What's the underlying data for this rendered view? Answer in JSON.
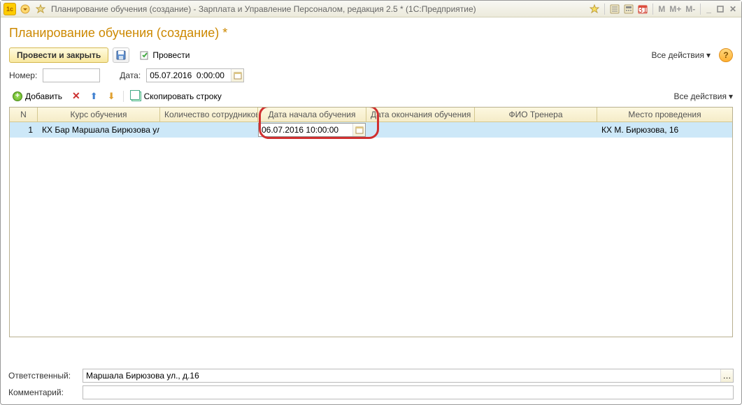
{
  "titlebar": {
    "title": "Планирование обучения (создание) - Зарплата и Управление Персоналом, редакция 2.5 *  (1С:Предприятие)",
    "m_buttons": [
      "M",
      "M+",
      "M-"
    ]
  },
  "heading": "Планирование обучения (создание) *",
  "toolbar1": {
    "main_button": "Провести и закрыть",
    "process_label": "Провести",
    "all_actions": "Все действия"
  },
  "form": {
    "number_label": "Номер:",
    "number_value": "",
    "date_label": "Дата:",
    "date_value": "05.07.2016  0:00:00"
  },
  "toolbar2": {
    "add_label": "Добавить",
    "copy_label": "Скопировать строку",
    "all_actions": "Все действия"
  },
  "table": {
    "headers": [
      "N",
      "Курс обучения",
      "Количество сотрудников",
      "Дата начала обучения",
      "Дата окончания обучения",
      "ФИО Тренера",
      "Место проведения"
    ],
    "rows": [
      {
        "n": "1",
        "course": "КХ Бар Маршала Бирюзова ул.,...",
        "count": "",
        "start": "06.07.2016 10:00:00",
        "end": "",
        "trainer": "",
        "place": "КХ М. Бирюзова, 16"
      }
    ]
  },
  "bottom": {
    "responsible_label": "Ответственный:",
    "responsible_value": "Маршала Бирюзова ул., д.16",
    "comment_label": "Комментарий:",
    "comment_value": ""
  }
}
